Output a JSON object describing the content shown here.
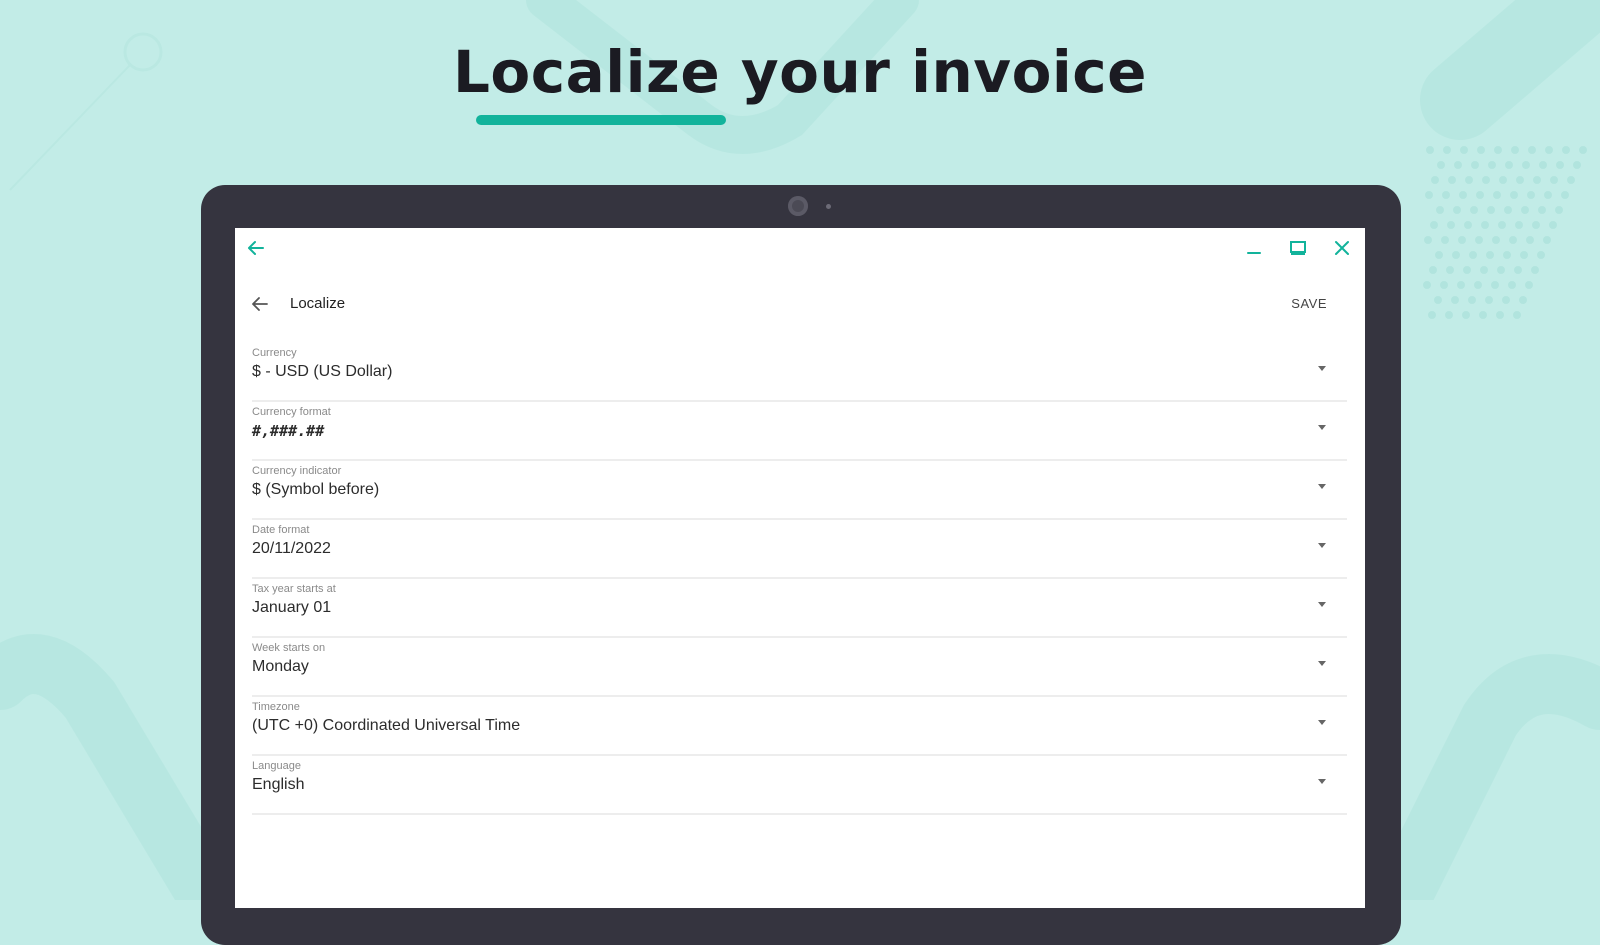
{
  "headline": {
    "text": "Localize your invoice",
    "underline_color": "#12b39b"
  },
  "window": {
    "back_icon": "arrow-left-icon",
    "controls": [
      "minimize-icon",
      "maximize-icon",
      "close-icon"
    ],
    "accent_color": "#12b39b"
  },
  "appbar": {
    "back_icon": "arrow-left-icon",
    "title": "Localize",
    "save_label": "SAVE"
  },
  "settings": [
    {
      "label": "Currency",
      "value": "$ - USD (US Dollar)"
    },
    {
      "label": "Currency format",
      "value": "#,###.##"
    },
    {
      "label": "Currency indicator",
      "value": "$ (Symbol before)"
    },
    {
      "label": "Date format",
      "value": "20/11/2022"
    },
    {
      "label": "Tax year starts at",
      "value": "January 01"
    },
    {
      "label": "Week starts on",
      "value": "Monday"
    },
    {
      "label": "Timezone",
      "value": "(UTC +0) Coordinated Universal Time"
    },
    {
      "label": "Language",
      "value": "English"
    }
  ],
  "colors": {
    "background": "#c2ece7",
    "device_frame": "#35343f",
    "screen": "#ffffff"
  }
}
